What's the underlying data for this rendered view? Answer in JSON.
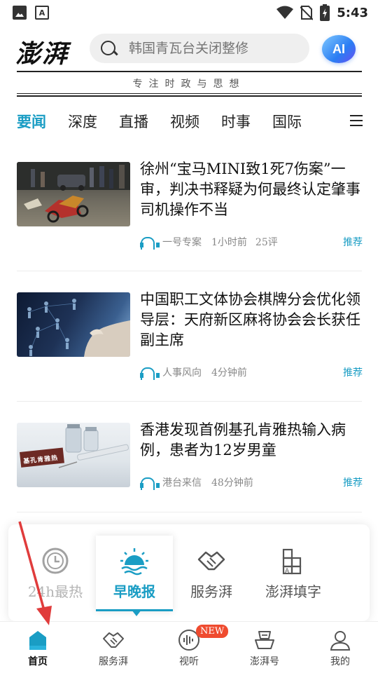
{
  "status_bar": {
    "time": "5:43",
    "left_icons": [
      "image-icon",
      "a-text-icon"
    ],
    "right_icons": [
      "wifi-icon",
      "no-sim-icon",
      "battery-charging-icon"
    ]
  },
  "header": {
    "logo_text": "澎湃",
    "search_placeholder": "韩国青瓦台关闭整修",
    "ai_label": "AI",
    "slogan": "专注时政与思想"
  },
  "tabs": [
    {
      "label": "要闻",
      "active": true
    },
    {
      "label": "深度",
      "active": false
    },
    {
      "label": "直播",
      "active": false
    },
    {
      "label": "视频",
      "active": false
    },
    {
      "label": "时事",
      "active": false
    },
    {
      "label": "国际",
      "active": false
    }
  ],
  "news": [
    {
      "title": "徐州“宝马MINI致1死7伤案”一审，判决书释疑为何最终认定肇事司机操作不当",
      "source": "一号专案",
      "time": "1小时前",
      "comments": "25评",
      "tag": "推荐"
    },
    {
      "title": "中国职工文体协会棋牌分会优化领导层：天府新区麻将协会会长获任副主席",
      "source": "人事风向",
      "time": "4分钟前",
      "comments": "",
      "tag": "推荐"
    },
    {
      "title": "香港发现首例基孔肯雅热输入病例，患者为12岁男童",
      "source": "港台来信",
      "time": "48分钟前",
      "comments": "",
      "tag": "推荐",
      "thumb_text": "基孔肯雅热"
    }
  ],
  "services": [
    {
      "label": "24h最热",
      "icon": "clock-icon",
      "active": false,
      "faded": true
    },
    {
      "label": "早晚报",
      "icon": "sunrise-icon",
      "active": true,
      "faded": false
    },
    {
      "label": "服务湃",
      "icon": "handshake-icon",
      "active": false,
      "faded": false
    },
    {
      "label": "澎湃填字",
      "icon": "crossword-icon",
      "active": false,
      "faded": false
    }
  ],
  "tabbar": [
    {
      "label": "首页",
      "icon": "home-icon",
      "active": true
    },
    {
      "label": "服务湃",
      "icon": "handshake-icon",
      "active": false
    },
    {
      "label": "视听",
      "icon": "waveform-icon",
      "active": false,
      "badge": "NEW"
    },
    {
      "label": "澎湃号",
      "icon": "ship-icon",
      "active": false
    },
    {
      "label": "我的",
      "icon": "user-icon",
      "active": false
    }
  ],
  "colors": {
    "accent": "#1a9dc4",
    "badge": "#ef4b2f",
    "annotation_arrow": "#e03c3c"
  }
}
